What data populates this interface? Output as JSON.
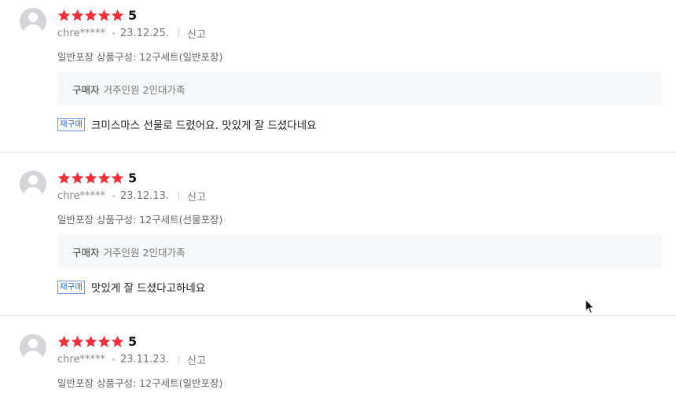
{
  "reviews": [
    {
      "score": "5",
      "user": "chre*****",
      "date": "23.12.25.",
      "report_label": "신고",
      "option": "일반포장 상품구성: 12구세트(일반포장)",
      "buyer_key": "구매자",
      "buyer_value": "거주인원 2인대가족",
      "badge": "재구매",
      "content": "크미스마스 선물로 드렸어요. 맛있게 잘 드셨다네요",
      "stars": 5
    },
    {
      "score": "5",
      "user": "chre*****",
      "date": "23.12.13.",
      "report_label": "신고",
      "option": "일반포장 상품구성: 12구세트(선물포장)",
      "buyer_key": "구매자",
      "buyer_value": "거주인원 2인대가족",
      "badge": "재구매",
      "content": "맛있게 잘 드셨다고하네요",
      "stars": 5
    },
    {
      "score": "5",
      "user": "chre*****",
      "date": "23.11.23.",
      "report_label": "신고",
      "option": "일반포장 상품구성: 12구세트(일반포장)",
      "stars": 5
    }
  ],
  "colors": {
    "star": "#f2303d",
    "badge": "#2f6fd8",
    "buyer_bg": "#f6f8f9"
  }
}
